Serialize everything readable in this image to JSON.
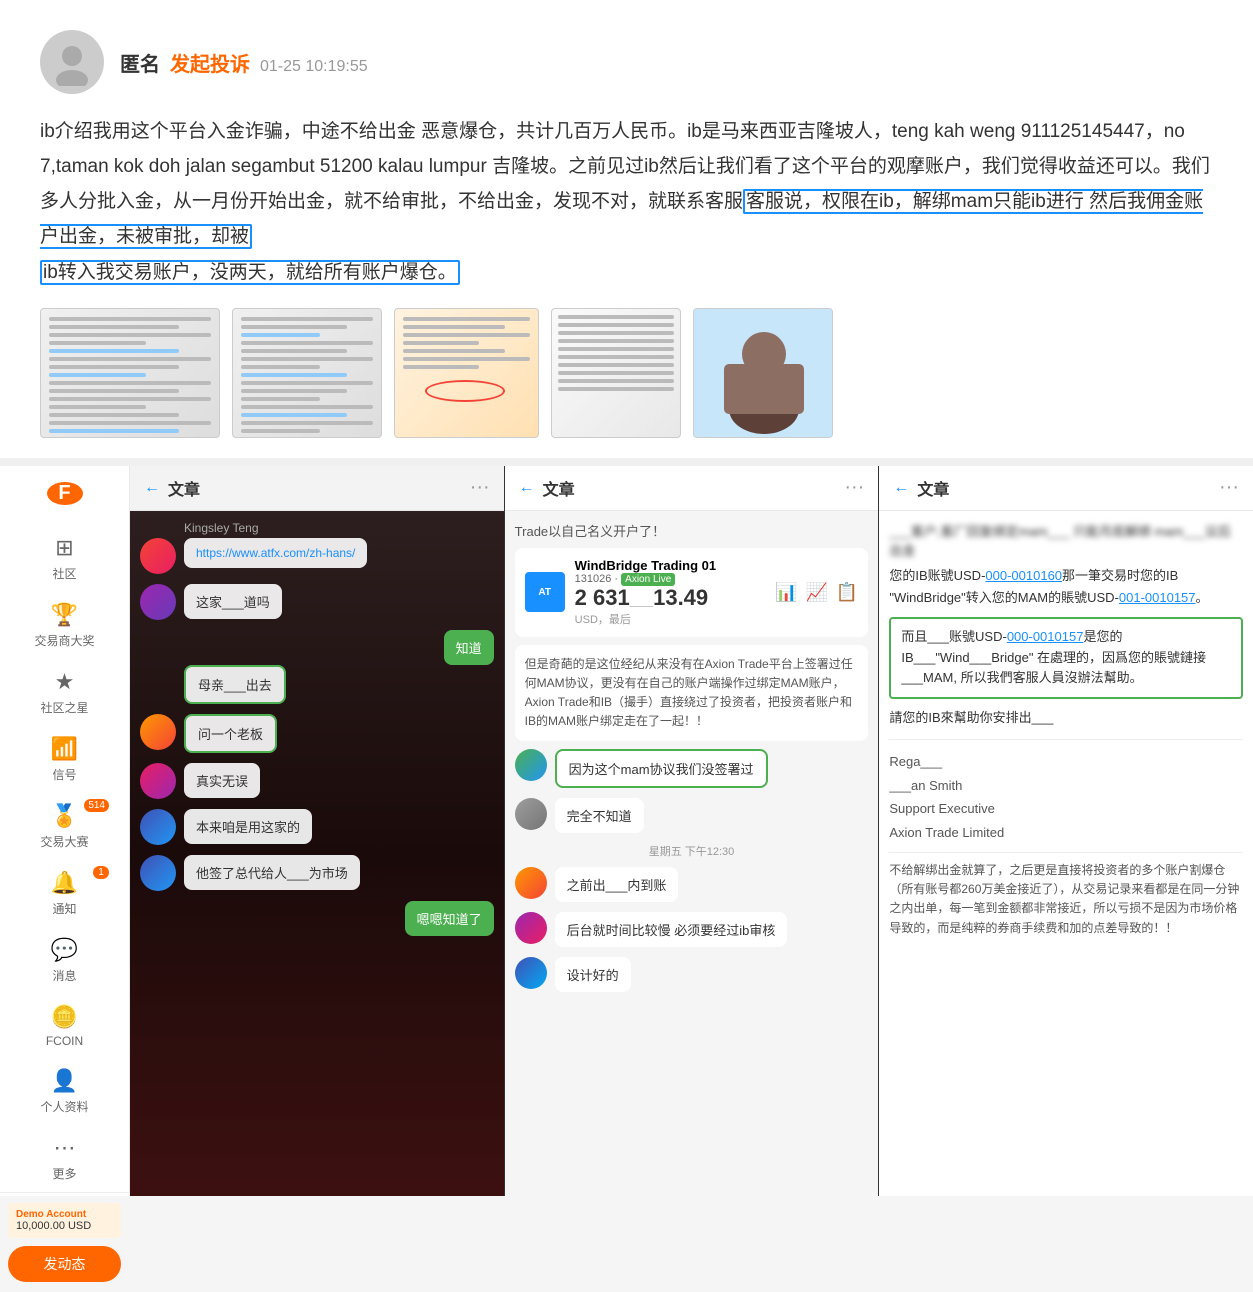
{
  "complaint": {
    "username": "匿名",
    "tag": "发起投诉",
    "time": "01-25 10:19:55",
    "text_part1": "ib介绍我用这个平台入金诈骗，中途不给出金 恶意爆仓，共计几百万人民币。ib是马来西亚吉隆坡人，teng kah weng 911125145447，no 7,taman kok doh jalan segambut 51200 kalau lumpur 吉隆坡。之前见过ib然后让我们看了这个平台的观摩账户，我们觉得收益还可以。我们多人分批入金，从一月份开始出金，就不给审批，不给出金，发现不对，就联系客服",
    "highlight1": "客服说，权限在ib，解绑mam只能ib进行 然后我佣金账户出金，未被审批，却被ib转入我交易账户，没两天，就给所有账户爆仓。",
    "text_cursor_visible": "客服说，权限在ib，解绑mam只能ib进行"
  },
  "sidebar": {
    "logo": "F",
    "items": [
      {
        "id": "community",
        "label": "社区",
        "icon": "⊞",
        "badge": null
      },
      {
        "id": "traders",
        "label": "交易商大奖",
        "icon": "🏆",
        "badge": null
      },
      {
        "id": "stars",
        "label": "社区之星",
        "icon": "★",
        "badge": null
      },
      {
        "id": "signals",
        "label": "信号",
        "icon": "📶",
        "badge": null
      },
      {
        "id": "contest",
        "label": "交易大赛",
        "icon": "🏅",
        "badge": "514"
      },
      {
        "id": "notify",
        "label": "通知",
        "icon": "🔔",
        "badge": "1"
      },
      {
        "id": "messages",
        "label": "消息",
        "icon": "💬",
        "badge": null
      },
      {
        "id": "fcoin",
        "label": "FCOIN",
        "icon": "🪙",
        "badge": null
      },
      {
        "id": "profile",
        "label": "个人资料",
        "icon": "👤",
        "badge": null
      },
      {
        "id": "more",
        "label": "更多",
        "icon": "⋯",
        "badge": null
      }
    ],
    "demo_account": {
      "label": "Demo Account",
      "value": "10,000.00 USD"
    },
    "post_button": "发动态"
  },
  "panel1": {
    "title": "文章",
    "back_label": "←",
    "more_label": "···",
    "name_label": "Kingsley Teng",
    "messages": [
      {
        "type": "right",
        "text": "知道",
        "style": "green"
      },
      {
        "type": "left",
        "text": "母亲___出去",
        "style": "green_border"
      },
      {
        "type": "left",
        "text": "问一个老板",
        "style": "green_border"
      },
      {
        "type": "left",
        "text": "真实无误",
        "style": "normal"
      },
      {
        "type": "left",
        "text": "本来咱是用这家的",
        "style": "normal"
      },
      {
        "type": "left",
        "text": "他签了总代给人___为市场",
        "style": "normal"
      },
      {
        "type": "right",
        "text": "嗯嗯知道了",
        "style": "green"
      }
    ],
    "link_text": "https://www.atfx.com/zh-hans/",
    "question_text": "这家___道吗"
  },
  "panel2": {
    "title": "文章",
    "back_label": "←",
    "more_label": "···",
    "subtitle": "Trade以自己名义开户了！",
    "broker_name": "WindBridge Trading 01",
    "account_id": "131026 - Axion_Live",
    "amount": "2 631___13.49",
    "currency": "USD，最后",
    "body_text": "但是奇葩的是这位经纪从来没有在Axion Trade平台上签署过任何MAM协议，更没有在自己的账户端操作过绑定MAM账户，Axion Trade和IB（撮手）直接绕过了投资者，把投资者账户和IB的MAM账户绑定走在了一起！！",
    "messages": [
      {
        "type": "left",
        "text": "因为这个mam协议我们没签署过",
        "style": "green_border"
      },
      {
        "type": "left",
        "text": "完全不知道",
        "style": "normal"
      },
      {
        "type": "left",
        "text": "之前出___内到账",
        "style": "normal"
      },
      {
        "type": "left",
        "text": "后台就时间比较慢 必须要经过ib审核",
        "style": "normal"
      },
      {
        "type": "left",
        "text": "设计好的",
        "style": "normal"
      }
    ],
    "time_label": "星期五 下午12:30"
  },
  "panel3": {
    "title": "文章",
    "back_label": "←",
    "more_label": "···",
    "blurred_text1": "___客户,客厂回复绑定mam___",
    "blurred_text2": "___只能月底解绑 mam___议后出金",
    "body1": "您的IB账號USD-",
    "link1": "000-0010160",
    "body2": "那一筆交易时您的IB \"WindBridge\"转入您的MAM的賬號USD-",
    "link2": "001-0010157",
    "body3": "。",
    "box_text": "而且___账號USD-000-0010157是您的IB___\"Wind___Bridge\" 在處理的，因爲您的賬號鏈接___MAM, 所以我們客服人員沒辦法幫助。",
    "body4": "請您的IB來幫助你安排出___",
    "regards": "Rega___",
    "name": "___an Smith",
    "title2": "Support Executive",
    "company": "Axion Trade Limited",
    "footer": "不给解绑出金就算了，之后更是直接将投资者的多个账户割爆仓（所有账号都260万美金接近了），从交易记录来看都是在同一分钟之内出单，每一笔到金额都非常接近，所以亏损不是因为市场价格导致的，而是纯粹的券商手续费和加的点差导致的！！"
  }
}
